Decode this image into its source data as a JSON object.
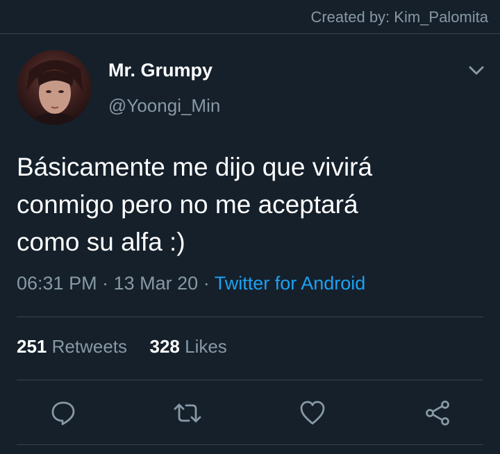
{
  "watermark": {
    "text": "Created by: Kim_Palomita"
  },
  "author": {
    "display_name": "Mr. Grumpy",
    "handle": "@Yoongi_Min"
  },
  "tweet": {
    "lines": [
      "Básicamente me dijo que vivirá",
      "conmigo pero no me aceptará",
      "como su alfa :)"
    ],
    "time": "06:31 PM",
    "separator_1": "·",
    "date": "13 Mar 20",
    "separator_2": "·",
    "source": "Twitter for Android"
  },
  "stats": {
    "retweets_count": "251",
    "retweets_label": "Retweets",
    "likes_count": "328",
    "likes_label": "Likes"
  },
  "icons": {
    "more": "chevron-down-icon",
    "reply": "reply-icon",
    "retweet": "retweet-icon",
    "like": "heart-icon",
    "share": "share-icon"
  },
  "colors": {
    "background": "#15202b",
    "secondary_text": "#8899a6",
    "link": "#1da1f2",
    "divider": "#38444d"
  }
}
